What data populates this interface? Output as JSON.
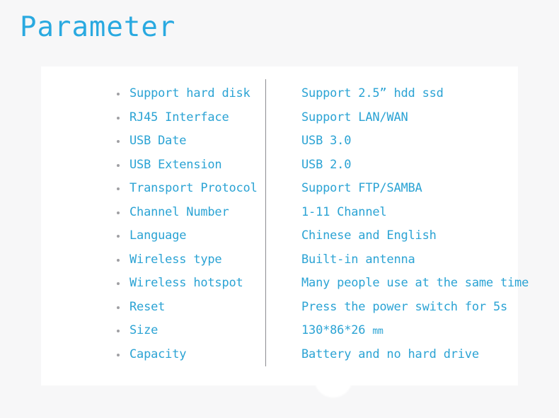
{
  "page": {
    "title": "Parameter",
    "background_color": "#f7f7f8",
    "card_color": "#ffffff",
    "accent_color": "#29a9e0",
    "text_color": "#2ba3d4",
    "bullet_color": "#a0a0a4",
    "divider_color": "#8d8d91"
  },
  "spec_table": {
    "rows": [
      {
        "label": "Support hard disk",
        "value": "Support 2.5” hdd ssd"
      },
      {
        "label": "RJ45 Interface",
        "value": "Support LAN/WAN"
      },
      {
        "label": "USB Date",
        "value": "USB 3.0"
      },
      {
        "label": "USB Extension",
        "value": "USB 2.0"
      },
      {
        "label": "Transport Protocol",
        "value": "Support FTP/SAMBA"
      },
      {
        "label": "Channel Number",
        "value": "1-11 Channel"
      },
      {
        "label": "Language",
        "value": "Chinese and English"
      },
      {
        "label": "Wireless type",
        "value": "Built-in antenna"
      },
      {
        "label": "Wireless hotspot",
        "value": "Many people use at the same time"
      },
      {
        "label": "Reset",
        "value": "Press the power switch for 5s"
      },
      {
        "label": "Size",
        "value": "130*86*26 ",
        "value_unit": "mm"
      },
      {
        "label": "Capacity",
        "value": "Battery and no hard drive"
      }
    ]
  }
}
